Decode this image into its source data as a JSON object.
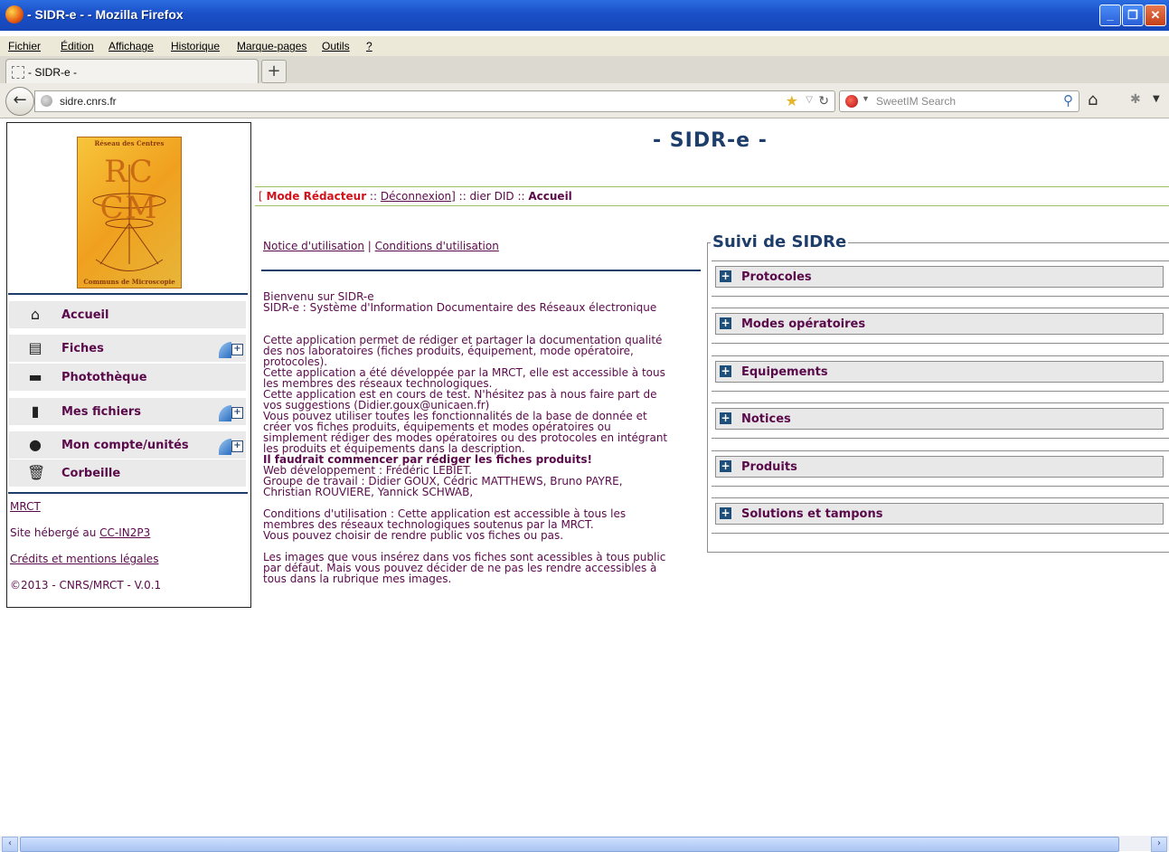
{
  "window": {
    "title": " - SIDR-e - - Mozilla Firefox"
  },
  "menu": [
    "Fichier",
    "Édition",
    "Affichage",
    "Historique",
    "Marque-pages",
    "Outils",
    "?"
  ],
  "tab": {
    "label": " - SIDR-e - "
  },
  "urlbar": {
    "url": "sidre.cnrs.fr"
  },
  "searchbar": {
    "placeholder": "SweetIM Search"
  },
  "logo": {
    "top": "Réseau des Centres",
    "initials": "RC  CM",
    "bottom": "Communs de Microscopie"
  },
  "sidebar": {
    "items": [
      {
        "label": "Accueil",
        "icon": "home-icon"
      },
      {
        "label": "Fiches",
        "icon": "clipboard-icon"
      },
      {
        "label": "Photothèque",
        "icon": "camera-icon"
      },
      {
        "label": "Mes fichiers",
        "icon": "folder-icon"
      },
      {
        "label": "Mon compte/unités",
        "icon": "user-icon"
      },
      {
        "label": "Corbeille",
        "icon": "trash-icon"
      }
    ],
    "footer": {
      "mrct": "MRCT",
      "hosted_prefix": "Site hébergé au ",
      "hosted_link": "CC-IN2P3",
      "credits": "Crédits et mentions légales",
      "copyright": "©2013 - CNRS/MRCT - V.0.1"
    }
  },
  "page": {
    "title": "- SIDR-e -",
    "status": {
      "open": "[ ",
      "mode": "Mode Rédacteur",
      "sep1": " :: ",
      "logout": "Déconnexion",
      "middle": "] :: dier DID :: ",
      "current": "Accueil"
    },
    "links": {
      "notice": "Notice d'utilisation",
      "sep": " | ",
      "conditions": "Conditions d'utilisation"
    },
    "intro": [
      "Bienvenu sur SIDR-e",
      "SIDR-e : Système d'Information Documentaire des Réseaux électronique"
    ],
    "body1": [
      "Cette application permet de rédiger et partager la documentation qualité",
      "des nos laboratoires (fiches produits, équipement, mode opératoire,",
      "protocoles).",
      "Cette application a été développée par la MRCT, elle est accessible à tous",
      "les membres des réseaux technologiques.",
      "Cette application est en cours de test. N'hésitez pas à nous faire part de",
      "vos suggestions (Didier.goux@unicaen.fr)",
      "Vous pouvez utiliser toutes les fonctionnalités de la base de donnée et",
      "créer vos fiches produits, équipements et modes opératoires ou",
      "simplement rédiger des modes opératoires ou des protocoles en intégrant",
      "les produits et équipements dans la description."
    ],
    "bold_line": "Il faudrait commencer par rédiger les fiches produits!",
    "body2": [
      "Web développement : Frédéric LEBIET.",
      "Groupe de travail : Didier GOUX, Cédric MATTHEWS, Bruno PAYRE,",
      "Christian ROUVIERE, Yannick SCHWAB,"
    ],
    "body3": [
      "Conditions d'utilisation : Cette application est accessible à tous les",
      "membres des réseaux technologiques soutenus par la MRCT.",
      "Vous pouvez choisir de rendre public vos fiches ou pas."
    ],
    "body4": [
      "Les images que vous insérez dans vos fiches sont acessibles à tous public",
      "par défaut. Mais vous pouvez décider de ne pas les rendre accessibles à",
      "tous dans la rubrique mes images."
    ]
  },
  "suivi": {
    "legend": "Suivi de SIDRe",
    "items": [
      "Protocoles",
      "Modes opératoires",
      "Equipements",
      "Notices",
      "Produits",
      "Solutions et tampons"
    ]
  }
}
